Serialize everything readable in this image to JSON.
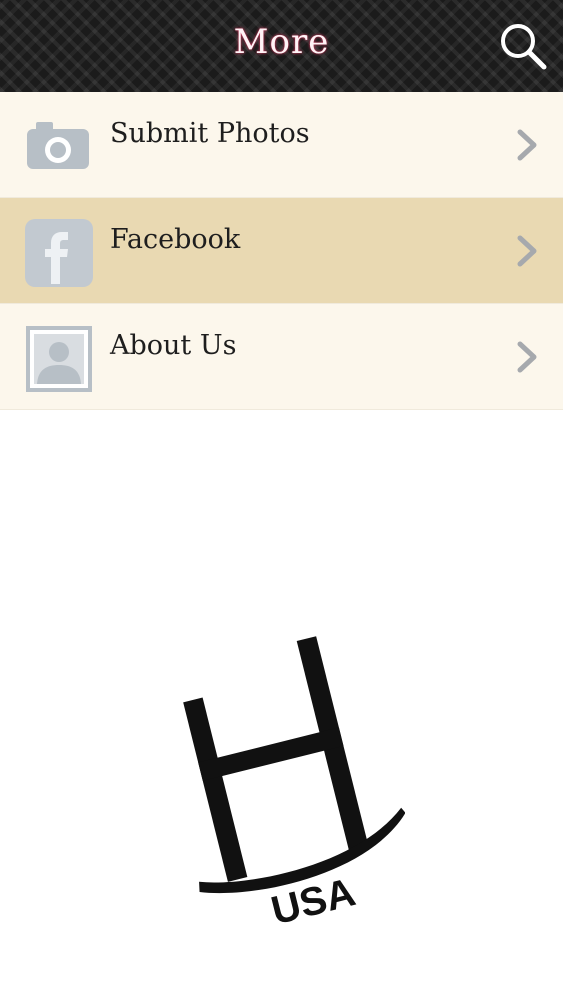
{
  "header": {
    "title": "More",
    "search_icon": "search-icon"
  },
  "menu": {
    "items": [
      {
        "label": "Submit Photos",
        "icon": "camera-icon"
      },
      {
        "label": "Facebook",
        "icon": "facebook-icon",
        "selected": true
      },
      {
        "label": "About Us",
        "icon": "person-icon"
      }
    ]
  },
  "logo": {
    "text": "USA",
    "icon": "chair-logo"
  },
  "colors": {
    "header_bg": "#1b1b1b",
    "item_bg": "#fcf7ec",
    "item_selected_bg": "#e9d9b2",
    "icon_gray": "#b7bfc6",
    "chevron_gray": "#a6a9ad"
  }
}
